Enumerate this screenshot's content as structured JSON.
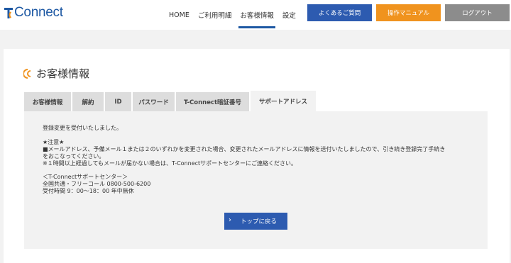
{
  "header": {
    "logo_text": "Connect",
    "nav": [
      "HOME",
      "ご利用明細",
      "お客様情報",
      "設定"
    ],
    "faq_label": "よくあるご質問",
    "manual_label": "操作マニュアル",
    "logout_label": "ログアウト"
  },
  "page": {
    "title": "お客様情報"
  },
  "tabs": [
    "お客様情報",
    "解約",
    "ID",
    "パスワード",
    "T-Connect暗証番号",
    "サポートアドレス"
  ],
  "content": {
    "message": "登録変更を受付いたしました。",
    "notice_heading": "★注意★",
    "notice_line1": "■メールアドレス、予備メール１または２のいずれかを変更された場合、変更されたメールアドレスに情報を送付いたしましたので、引き続き登録完了手続き",
    "notice_line2": "をおこなってください。",
    "notice_line3": "※１時間以上経過してもメールが届かない場合は、T-Connectサポートセンターにご連絡ください。",
    "center_name": "＜T-Connectサポートセンター＞",
    "center_phone": "全国共通・フリーコール 0800-500-6200",
    "center_hours": "受付時間 9：00～18：00 年中無休",
    "back_label": "トップに戻る"
  },
  "colors": {
    "brand_blue": "#1d58a3",
    "button_blue": "#2d5bb0",
    "accent_orange": "#f0931e",
    "logout_gray": "#8c8c8c"
  }
}
